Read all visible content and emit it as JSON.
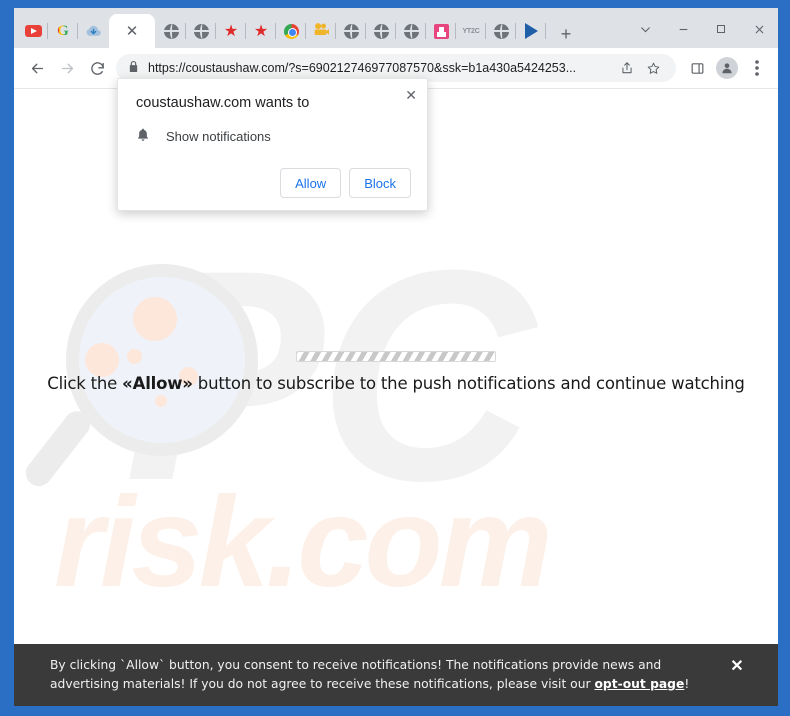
{
  "window": {
    "controls": {
      "tab_search": "⌄",
      "minimize": "—",
      "maximize": "❐",
      "close": "✕"
    }
  },
  "tabs": {
    "pinned": [
      {
        "name": "youtube",
        "icon": "youtube-icon"
      },
      {
        "name": "google",
        "icon": "google-icon",
        "glyph": "G"
      },
      {
        "name": "cloud-download",
        "icon": "cloud-download-icon",
        "glyph": "⬇"
      },
      {
        "name": "globe-1",
        "icon": "globe-icon"
      },
      {
        "name": "globe-2",
        "icon": "globe-icon"
      },
      {
        "name": "star-1",
        "icon": "star-icon",
        "glyph": "★"
      },
      {
        "name": "star-2",
        "icon": "star-icon",
        "glyph": "★"
      },
      {
        "name": "chrome",
        "icon": "chrome-icon"
      },
      {
        "name": "projector",
        "icon": "film-projector-icon",
        "glyph": "🎬"
      },
      {
        "name": "globe-3",
        "icon": "globe-icon"
      },
      {
        "name": "globe-4",
        "icon": "globe-icon"
      },
      {
        "name": "globe-5",
        "icon": "globe-icon"
      },
      {
        "name": "downloader",
        "icon": "download-box-icon"
      },
      {
        "name": "yt2c",
        "icon": "yt2c-icon",
        "glyph": "YT2C"
      },
      {
        "name": "globe-6",
        "icon": "globe-icon"
      },
      {
        "name": "play-blue",
        "icon": "play-triangle-icon"
      }
    ],
    "active_tab": {
      "title": "",
      "close_label": "✕"
    },
    "new_tab_label": "+"
  },
  "toolbar": {
    "back": "←",
    "forward": "→",
    "reload": "⟳",
    "lock": "🔒",
    "url": "https://coustaushaw.com/?s=690212746977087570&ssk=b1a430a5424253...",
    "share": "⇪",
    "bookmark": "☆",
    "side_panel": "❑",
    "avatar": "👤",
    "menu": "⋮"
  },
  "permission_dialog": {
    "title": "coustaushaw.com wants to",
    "permission_label": "Show notifications",
    "bell_icon": "🔔",
    "allow_label": "Allow",
    "block_label": "Block",
    "close_label": "✕"
  },
  "page": {
    "watermark_pc": "PC",
    "watermark_risk": "risk.com",
    "prompt_prefix": "Click the ",
    "prompt_highlight": "«Allow»",
    "prompt_suffix": " button to subscribe to the push notifications and continue watching",
    "progress_value": 100
  },
  "consent_banner": {
    "text_part1": "By clicking `Allow` button, you consent to receive notifications! The notifications provide news and advertising materials! If you do not agree to receive these notifications, please visit our ",
    "link_label": "opt-out page",
    "text_part2": "!",
    "close_label": "✕"
  },
  "colors": {
    "frame_blue": "#2a6fc4",
    "tab_strip": "#dee1e6",
    "accent_blue": "#1a73e8",
    "banner_bg": "#3a3a3a",
    "watermark_gray": "#f2f2f2",
    "watermark_peach": "#fcf0e8"
  }
}
